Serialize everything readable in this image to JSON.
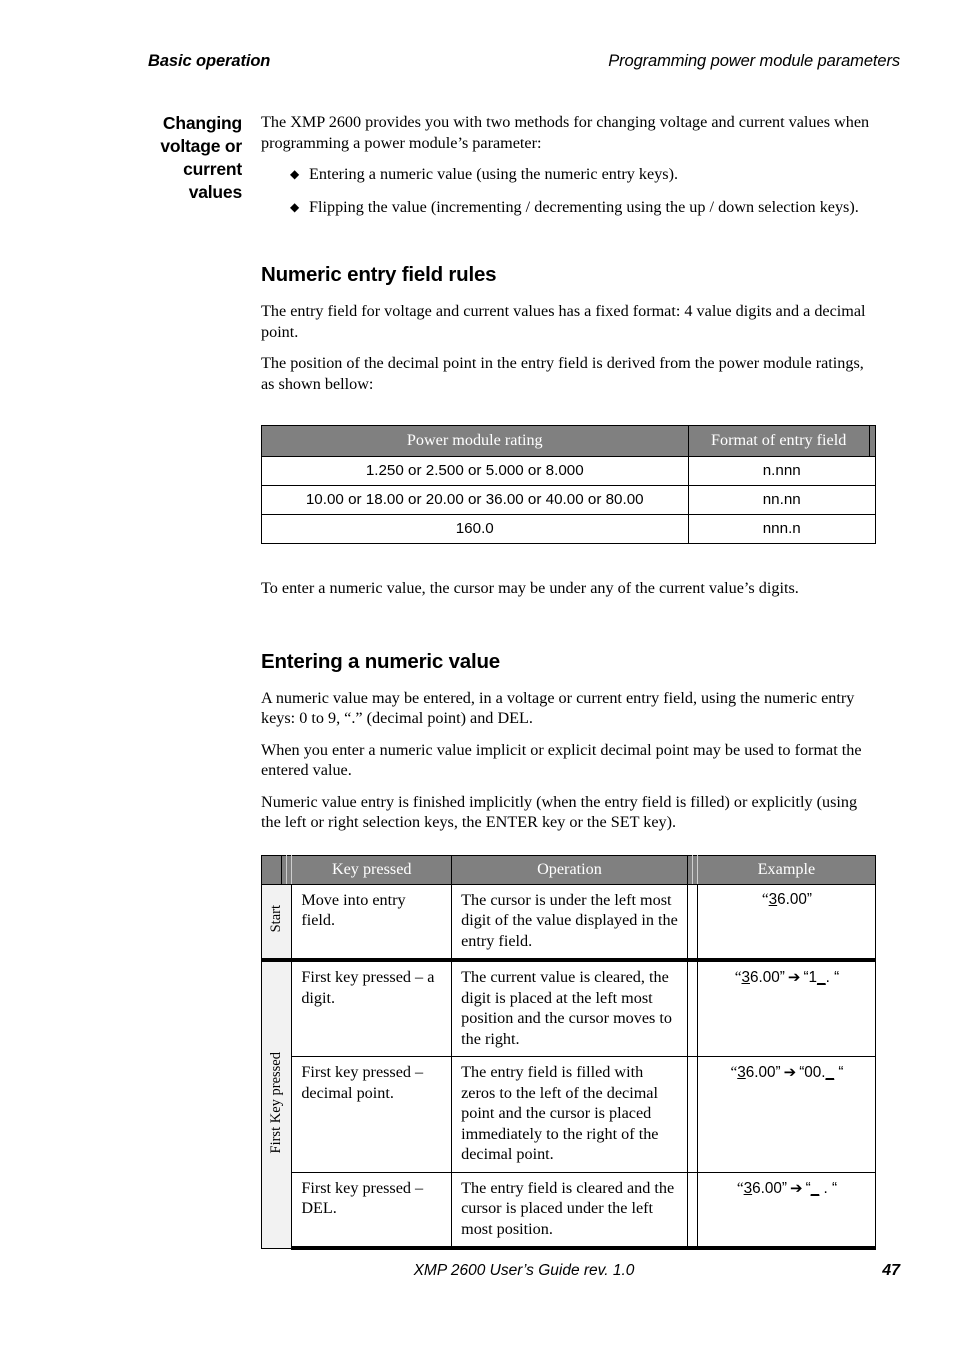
{
  "header": {
    "left": "Basic operation",
    "right": "Programming power module parameters"
  },
  "margin_heading": "Changing voltage or current values",
  "intro": {
    "paragraph": "The XMP 2600 provides you with two methods for changing voltage and current values when programming a power module’s parameter:",
    "bullets": [
      "Entering a numeric value (using the numeric entry keys).",
      "Flipping the value (incrementing / decrementing using the up / down selection keys)."
    ]
  },
  "section_rules": {
    "title": "Numeric entry field rules",
    "p1": "The entry field for voltage and current values has a fixed format: 4 value digits and a decimal point.",
    "p2": "The position of the decimal point in the entry field is derived from the power module ratings, as shown bellow:",
    "p3": "To enter a numeric value, the cursor may be under any of the current value’s digits.",
    "table": {
      "headers": [
        "Power module rating",
        "Format of entry field"
      ],
      "rows": [
        [
          "1.250 or 2.500 or 5.000 or 8.000",
          "n.nnn"
        ],
        [
          "10.00 or 18.00 or 20.00 or 36.00 or 40.00 or 80.00",
          "nn.nn"
        ],
        [
          "160.0",
          "nnn.n"
        ]
      ]
    }
  },
  "section_entering": {
    "title": "Entering a numeric value",
    "p1": "A numeric value may be entered, in a voltage or current entry field, using the numeric entry keys: 0 to 9, “.” (decimal point) and DEL.",
    "p2": "When you enter a numeric value implicit or explicit decimal point may be used to format the entered value.",
    "p3": "Numeric value entry is finished implicitly (when the entry field is filled) or explicitly (using the left or right selection keys, the ENTER key or the SET key).",
    "table": {
      "headers": [
        "",
        "Key pressed",
        "Operation",
        "Example"
      ],
      "groups": [
        {
          "label": "Start",
          "rows": [
            {
              "key": "Move into entry field.",
              "operation": "The cursor is under the left most digit of the value displayed in the entry field.",
              "example_before_cursor": "“",
              "example_cursor_digit": "3",
              "example_after": "6.00”",
              "example_arrow": "",
              "example_result": ""
            }
          ]
        },
        {
          "label": "First Key pressed",
          "rows": [
            {
              "key": "First key pressed – a digit.",
              "operation": "The current value is cleared, the digit is placed at the left most position and the cursor moves to the right.",
              "example_before_cursor": "“",
              "example_cursor_digit": "3",
              "example_after": "6.00”",
              "example_arrow": "➔",
              "example_result_pre": "“1",
              "example_result_cursor": "_",
              "example_result_post": ". “"
            },
            {
              "key": "First key pressed – decimal point.",
              "operation": "The entry field is filled with zeros to the left of the decimal point and the cursor is placed immediately to the right of the decimal point.",
              "example_before_cursor": "“",
              "example_cursor_digit": "3",
              "example_after": "6.00”",
              "example_arrow": "➔",
              "example_result_pre": "“00.",
              "example_result_cursor": "_",
              "example_result_post": " “"
            },
            {
              "key": "First key pressed – DEL.",
              "operation": "The entry field is cleared and the cursor is placed under the left most position.",
              "example_before_cursor": "“",
              "example_cursor_digit": "3",
              "example_after": "6.00”",
              "example_arrow": "➔",
              "example_result_pre": "“",
              "example_result_cursor": "_",
              "example_result_post": " . “"
            }
          ]
        }
      ]
    }
  },
  "footer": {
    "text": "XMP 2600 User’s Guide rev. 1.0",
    "page": "47"
  },
  "colors": {
    "table_header_bg": "#808080",
    "table_header_fg": "#ffffff",
    "rotated_cell_bg": "#f2f2f2"
  }
}
